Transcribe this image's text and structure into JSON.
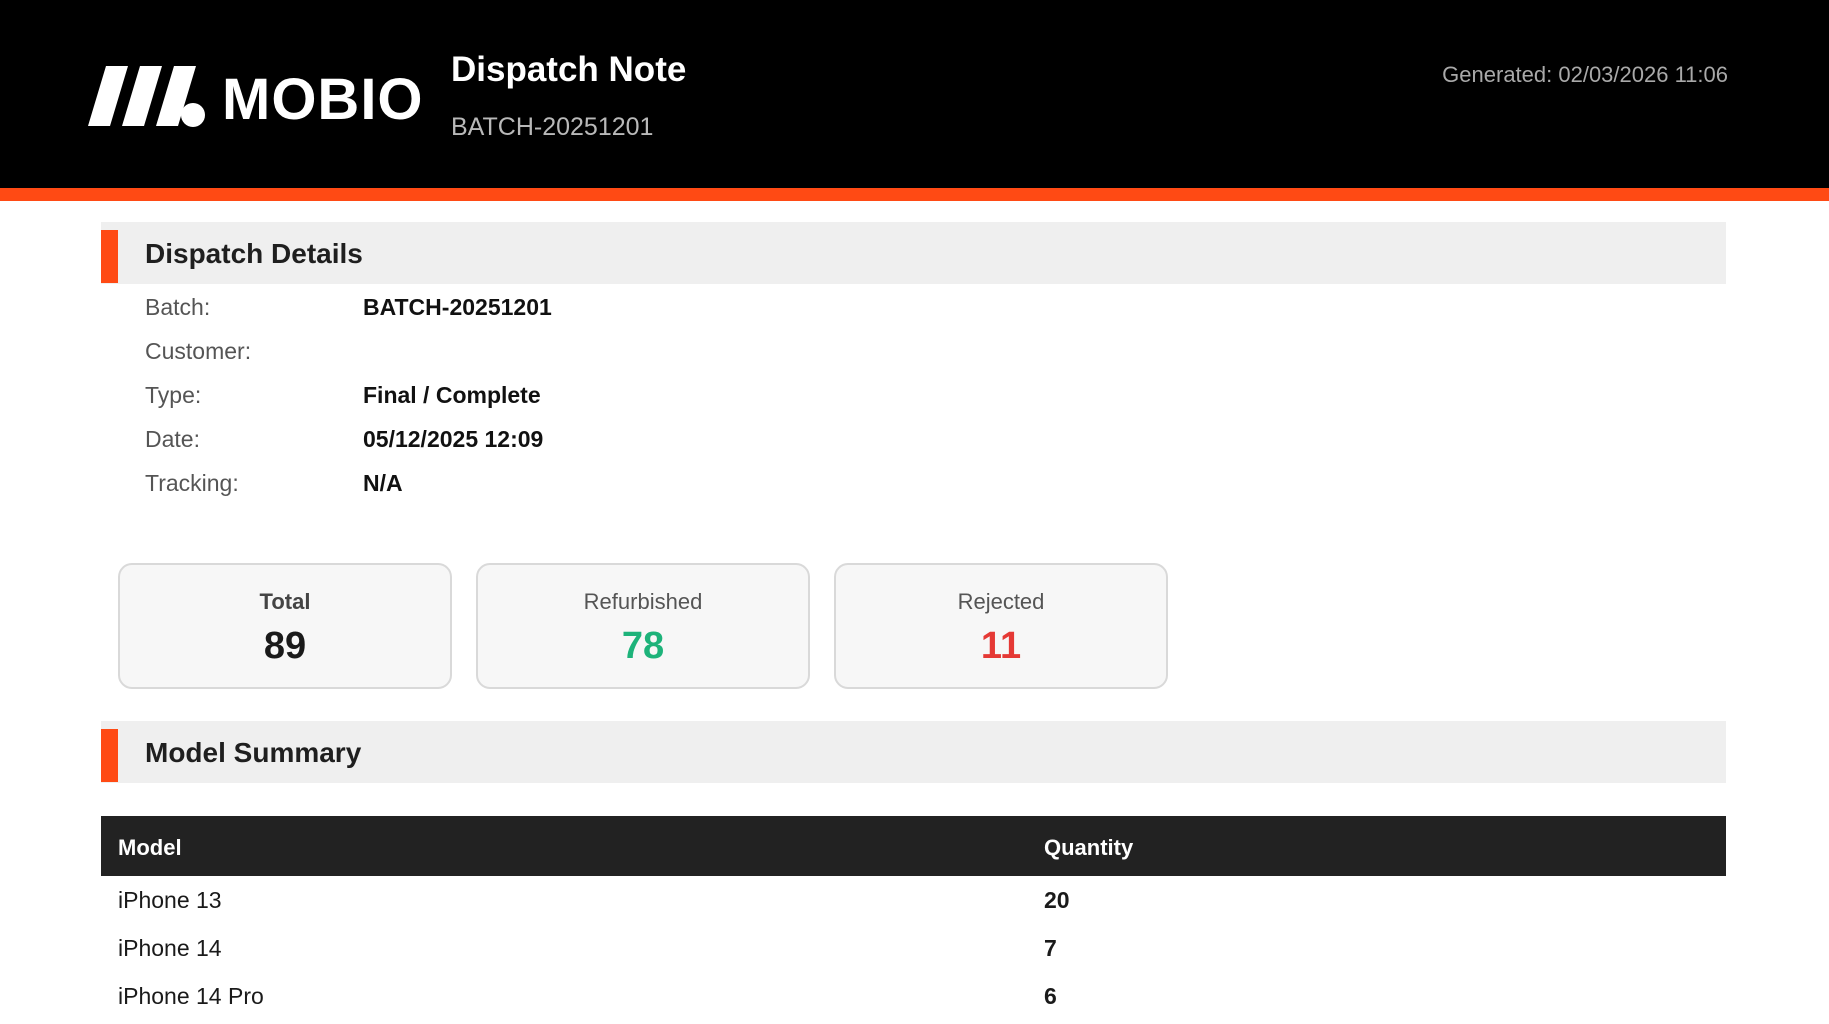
{
  "header": {
    "brand": "MOBIO",
    "title": "Dispatch Note",
    "batch": "BATCH-20251201",
    "generated": "Generated: 02/03/2026 11:06"
  },
  "colors": {
    "accent": "#ff4a14",
    "header_bg": "#000000",
    "refurbished": "#1db37a",
    "rejected": "#e53935"
  },
  "dispatch_details": {
    "title": "Dispatch Details",
    "rows": [
      {
        "label": "Batch:",
        "value": "BATCH-20251201"
      },
      {
        "label": "Customer:",
        "value": ""
      },
      {
        "label": "Type:",
        "value": "Final / Complete"
      },
      {
        "label": "Date:",
        "value": "05/12/2025 12:09"
      },
      {
        "label": "Tracking:",
        "value": "N/A"
      }
    ]
  },
  "stats": {
    "total": {
      "label": "Total",
      "value": "89"
    },
    "refurbished": {
      "label": "Refurbished",
      "value": "78"
    },
    "rejected": {
      "label": "Rejected",
      "value": "11"
    }
  },
  "model_summary": {
    "title": "Model Summary",
    "columns": [
      "Model",
      "Quantity"
    ],
    "rows": [
      {
        "model": "iPhone 13",
        "quantity": "20"
      },
      {
        "model": "iPhone 14",
        "quantity": "7"
      },
      {
        "model": "iPhone 14 Pro",
        "quantity": "6"
      }
    ]
  }
}
